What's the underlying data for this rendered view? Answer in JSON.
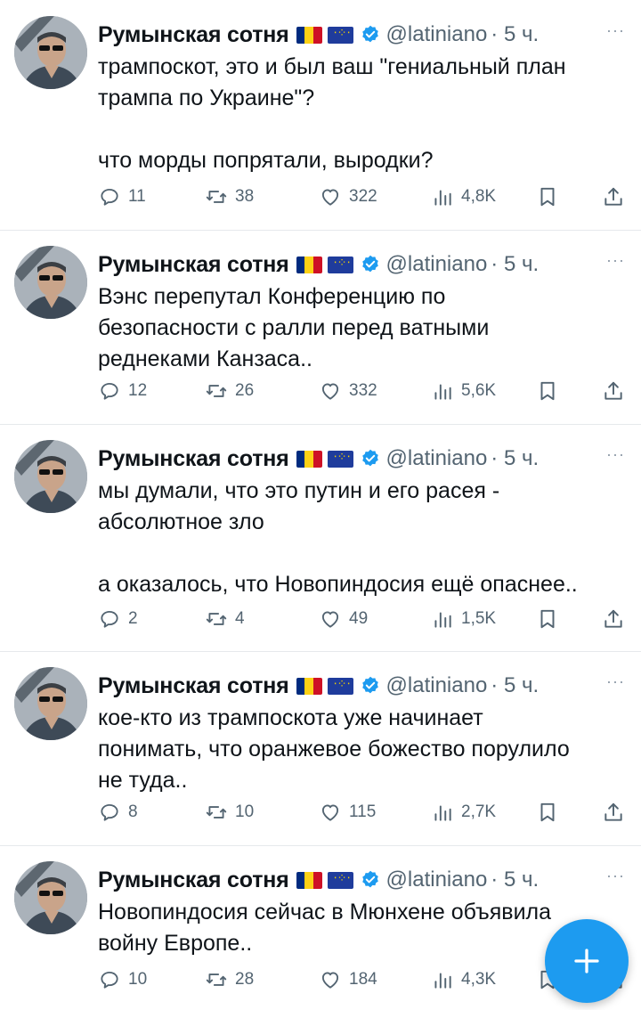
{
  "colors": {
    "accent": "#1d9bf0",
    "secondary_text": "#536471",
    "text": "#0f1419",
    "divider": "#e6e9ec"
  },
  "tweets": [
    {
      "name": "Румынская сотня",
      "handle": "@latiniano",
      "time": "· 5 ч.",
      "more": "···",
      "text": "трампоскот, это и был ваш \"гениальный план\nтрампа по Украине\"?\n\nчто морды попрятали, выродки?",
      "replies": "11",
      "retweets": "38",
      "likes": "322",
      "views": "4,8K"
    },
    {
      "name": "Румынская сотня",
      "handle": "@latiniano",
      "time": "· 5 ч.",
      "more": "···",
      "text": "Вэнс перепутал Конференцию по\nбезопасности с ралли перед ватными\nреднеками Канзаса..",
      "replies": "12",
      "retweets": "26",
      "likes": "332",
      "views": "5,6K"
    },
    {
      "name": "Румынская сотня",
      "handle": "@latiniano",
      "time": "· 5 ч.",
      "more": "···",
      "text": "мы думали, что это путин и его расея -\nабсолютное зло\n\nа оказалось, что Новопиндосия ещё опаснее..",
      "replies": "2",
      "retweets": "4",
      "likes": "49",
      "views": "1,5K"
    },
    {
      "name": "Румынская сотня",
      "handle": "@latiniano",
      "time": "· 5 ч.",
      "more": "···",
      "text": "кое-кто из трампоскота уже начинает\nпонимать, что оранжевое божество порулило\nне туда..",
      "replies": "8",
      "retweets": "10",
      "likes": "115",
      "views": "2,7K"
    },
    {
      "name": "Румынская сотня",
      "handle": "@latiniano",
      "time": "· 5 ч.",
      "more": "···",
      "text": "Новопиндосия сейчас в Мюнхене объявила\nвойну Европе..",
      "replies": "10",
      "retweets": "28",
      "likes": "184",
      "views": "4,3K"
    }
  ],
  "icons": {
    "reply": "reply-icon",
    "retweet": "retweet-icon",
    "like": "heart-icon",
    "views": "views-chart-icon",
    "bookmark": "bookmark-icon",
    "share": "share-icon",
    "compose": "plus-icon",
    "verified": "verified-badge-icon"
  }
}
